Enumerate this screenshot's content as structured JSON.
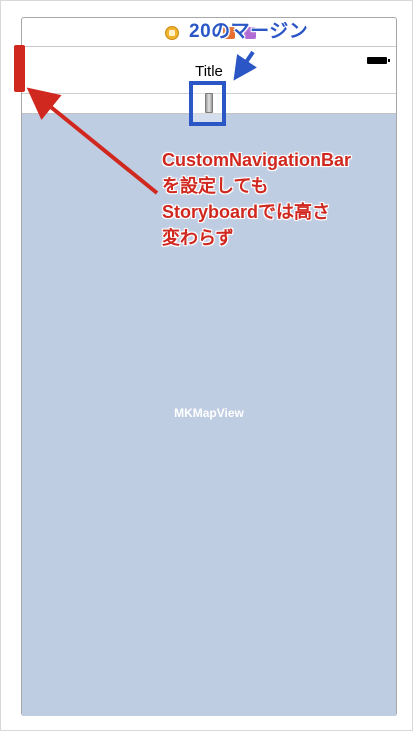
{
  "scene": {
    "nav_title": "Title",
    "map_label": "MKMapView"
  },
  "annotations": {
    "blue": "20のマージン",
    "red_lines": [
      "CustomNavigationBar",
      "を設定しても",
      "Storyboardでは高さ",
      "変わらず"
    ]
  },
  "colors": {
    "annotation_red": "#d0281f",
    "annotation_blue": "#2a56c6",
    "map_background": "#bfcde2"
  }
}
